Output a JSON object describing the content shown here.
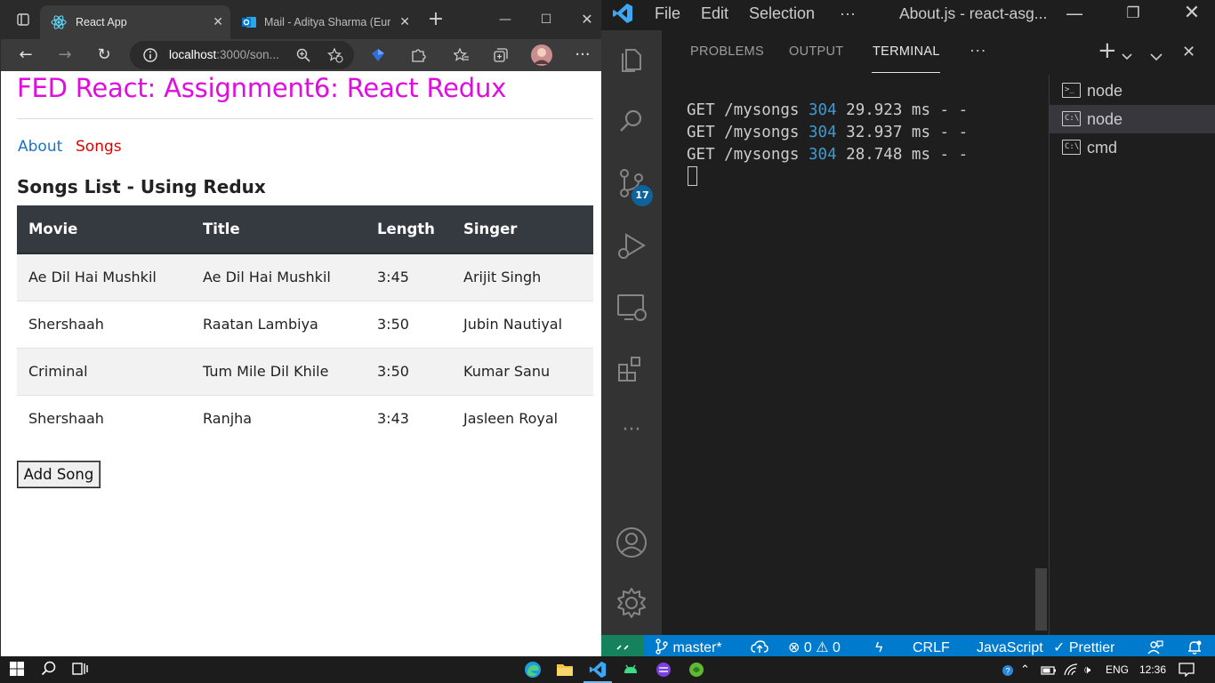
{
  "browser": {
    "tabs": [
      {
        "title": "React App",
        "active": true
      },
      {
        "title": "Mail - Aditya Sharma (Europ",
        "active": false
      }
    ],
    "address": {
      "host": "localhost",
      "path": ":3000/son..."
    },
    "page": {
      "heading": "FED React: Assignment6: React Redux",
      "nav": {
        "about": "About",
        "songs": "Songs"
      },
      "songs_heading": "Songs List - Using Redux",
      "table": {
        "headers": [
          "Movie",
          "Title",
          "Length",
          "Singer"
        ],
        "rows": [
          [
            "Ae Dil Hai Mushkil",
            "Ae Dil Hai Mushkil",
            "3:45",
            "Arijit Singh"
          ],
          [
            "Shershaah",
            "Raatan Lambiya",
            "3:50",
            "Jubin Nautiyal"
          ],
          [
            "Criminal",
            "Tum Mile Dil Khile",
            "3:50",
            "Kumar Sanu"
          ],
          [
            "Shershaah",
            "Ranjha",
            "3:43",
            "Jasleen Royal"
          ]
        ]
      },
      "add_button": "Add Song"
    },
    "colors": {
      "heading": "#e00ce0",
      "link": "#1a73c8",
      "active_link": "#e00000",
      "table_header": "#343a40"
    }
  },
  "vscode": {
    "menu": {
      "file": "File",
      "edit": "Edit",
      "selection": "Selection",
      "more": "···"
    },
    "title": "About.js - react-asg...",
    "panel_tabs": {
      "problems": "PROBLEMS",
      "output": "OUTPUT",
      "terminal": "TERMINAL",
      "more": "···"
    },
    "terminal_lines": [
      {
        "method": "GET",
        "path": "/mysongs",
        "status": "304",
        "time": "29.923 ms - -"
      },
      {
        "method": "GET",
        "path": "/mysongs",
        "status": "304",
        "time": "32.937 ms - -"
      },
      {
        "method": "GET",
        "path": "/mysongs",
        "status": "304",
        "time": "28.748 ms - -"
      }
    ],
    "terminals": [
      {
        "name": "node",
        "icon": ">_",
        "selected": false
      },
      {
        "name": "node",
        "icon": "C:\\",
        "selected": true
      },
      {
        "name": "cmd",
        "icon": "C:\\",
        "selected": false
      }
    ],
    "scm_badge": "17",
    "statusbar": {
      "branch": "master*",
      "errors": "0",
      "warnings": "0",
      "eol": "CRLF",
      "language": "JavaScript",
      "formatter": "Prettier"
    }
  },
  "taskbar": {
    "language": "ENG",
    "time": "12:36"
  }
}
